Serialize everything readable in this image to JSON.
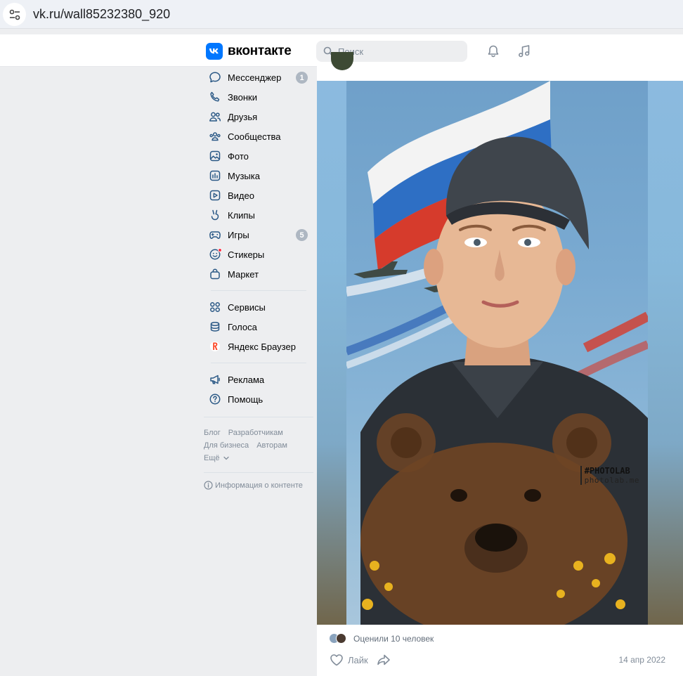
{
  "browser": {
    "url": "vk.ru/wall85232380_920"
  },
  "header": {
    "logo_text": "вконтакте",
    "search_placeholder": "Поиск",
    "icons": [
      "bell-icon",
      "music-icon"
    ]
  },
  "sidebar": {
    "items": [
      {
        "label": "Мессенджер",
        "icon": "chat-bubble-icon",
        "badge": "1"
      },
      {
        "label": "Звонки",
        "icon": "phone-icon"
      },
      {
        "label": "Друзья",
        "icon": "friends-icon"
      },
      {
        "label": "Сообщества",
        "icon": "communities-icon"
      },
      {
        "label": "Фото",
        "icon": "photo-icon"
      },
      {
        "label": "Музыка",
        "icon": "music-icon"
      },
      {
        "label": "Видео",
        "icon": "video-icon"
      },
      {
        "label": "Клипы",
        "icon": "clips-icon"
      },
      {
        "label": "Игры",
        "icon": "gamepad-icon",
        "badge": "5"
      },
      {
        "label": "Стикеры",
        "icon": "sticker-icon"
      },
      {
        "label": "Маркет",
        "icon": "bag-icon"
      }
    ],
    "items2": [
      {
        "label": "Сервисы",
        "icon": "services-icon"
      },
      {
        "label": "Голоса",
        "icon": "coins-icon"
      },
      {
        "label": "Яндекс Браузер",
        "icon": "yandex-browser-icon"
      }
    ],
    "items3": [
      {
        "label": "Реклама",
        "icon": "megaphone-icon"
      },
      {
        "label": "Помощь",
        "icon": "help-icon"
      }
    ],
    "footer_links": [
      [
        "Блог",
        "Разработчикам"
      ],
      [
        "Для бизнеса",
        "Авторам"
      ]
    ],
    "more_label": "Ещё",
    "info_label": "Информация о контенте"
  },
  "post": {
    "watermark_tag": "#PHOTOLAB",
    "watermark_site": "photolab.me",
    "likes_text": "Оценили 10 человек",
    "like_label": "Лайк",
    "date": "14 апр 2022"
  },
  "colors": {
    "accent": "#0077ff",
    "badge": "#aeb7c2",
    "muted_text": "#818c99",
    "background": "#edeef0"
  }
}
